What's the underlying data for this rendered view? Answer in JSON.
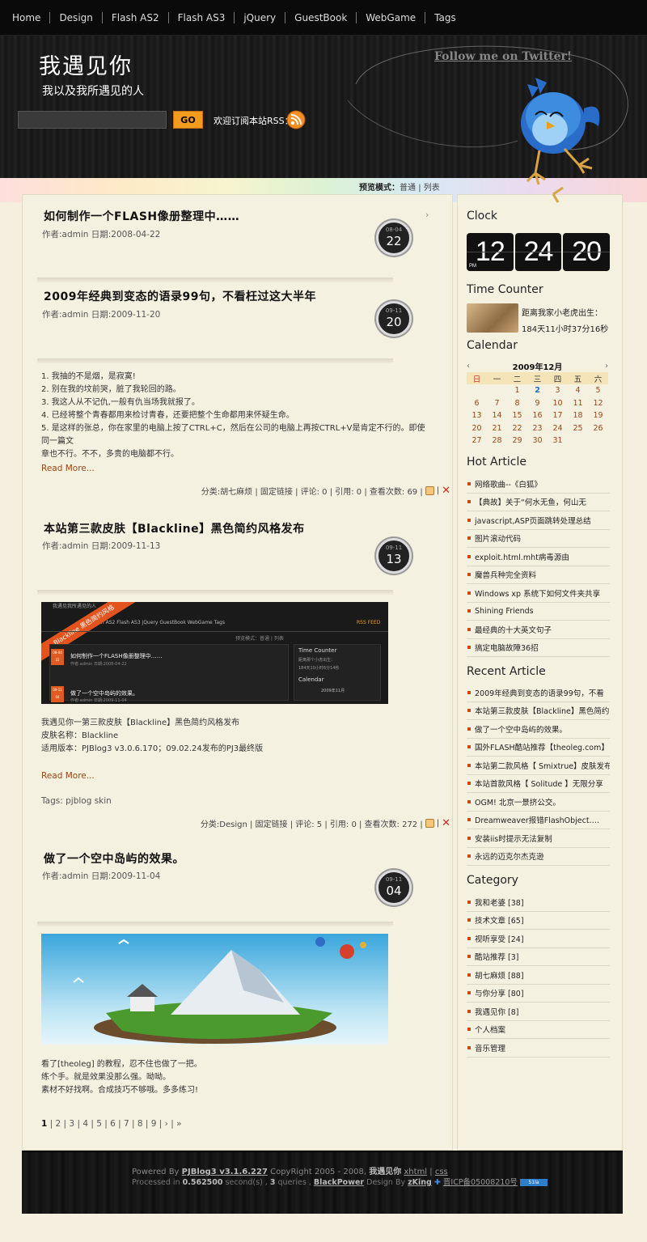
{
  "nav": {
    "items": [
      "Home",
      "Design",
      "Flash AS2",
      "Flash AS3",
      "jQuery",
      "GuestBook",
      "WebGame",
      "Tags"
    ]
  },
  "header": {
    "title": "我遇见你",
    "subtitle": "我以及我所遇见的人",
    "twitter": "Follow me on Twitter!",
    "search_button": "GO",
    "rss_label": "欢迎订阅本站RSS："
  },
  "preview": {
    "label": "预览模式：",
    "normal": "普通",
    "sep": "|",
    "list": "列表"
  },
  "posts": [
    {
      "title": "如何制作一个FLASH像册整理中……",
      "meta": "作者:admin  日期:2008-04-22",
      "month": "08-04",
      "day": "22"
    },
    {
      "title": "2009年经典到变态的语录99句，不看枉过这大半年",
      "meta": "作者:admin  日期:2009-11-20",
      "month": "09-11",
      "day": "20",
      "lines": [
        "1. 我抽的不是烟，是寂寞!",
        "2. 别在我的坟前哭，脏了我轮回的路。",
        "3. 我这人从不记仇,一般有仇当场我就报了。",
        "4. 已经将整个青春都用来检讨青春，还要把整个生命都用来怀疑生命。",
        "5. 是这样的张总，你在家里的电脑上按了CTRL+C，然后在公司的电脑上再按CTRL+V是肯定不行的。即使同一篇文",
        "章也不行。不不，多贵的电脑都不行。"
      ],
      "read_more": "Read More...",
      "footer": "分类:胡七麻烦 | 固定链接 | 评论: 0 | 引用: 0 | 查看次数: 69 |"
    },
    {
      "title": "本站第三款皮肤【Blackline】黑色简约风格发布",
      "meta": "作者:admin  日期:2009-11-13",
      "month": "09-11",
      "day": "13",
      "lines": [
        "我遇见你一第三款皮肤【Blackline】黑色简约风格发布",
        "皮肤名称：Blackline",
        "适用版本：PJBlog3 v3.0.6.170；09.02.24发布的PJ3最终版"
      ],
      "read_more": "Read More...",
      "tags": "Tags: pjblog skin",
      "footer": "分类:Design | 固定链接 | 评论: 5 | 引用: 0 | 查看次数: 272 |",
      "thumb": {
        "banner": "Blackline 黑色简约风格",
        "nav": "Flash AS2   Flash AS3   jQuery   GuestBook   WebGame   Tags",
        "rss": "RSS FEED",
        "site": "我遇见我所遇见的人",
        "preview": "预览模式：普通 | 列表",
        "p1": "如何制作一个FLASH像册整理中……",
        "p1_meta": "作者:admin  日期:2008-04-22",
        "p1_month": "08-04",
        "p1_day": "22",
        "p2": "做了一个空中岛屿的效果。",
        "p2_meta": "作者:admin  日期:2009-11-04",
        "p2_month": "09-11",
        "p2_day": "04",
        "side1": "Time Counter",
        "side1_text": "距离那个小虎出生：",
        "side1_val": "184天10小时6分14秒",
        "side2": "Calendar",
        "side2_month": "2009年11月"
      }
    },
    {
      "title": "做了一个空中岛屿的效果。",
      "meta": "作者:admin  日期:2009-11-04",
      "month": "09-11",
      "day": "04",
      "lines": [
        "看了[theoleg] 的教程，忍不住也做了一把。",
        "练个手。就是效果没那么强。呦呦。",
        "素材不好找啊。合成技巧不够哦。多多练习!"
      ]
    }
  ],
  "pager": {
    "current": "1",
    "rest": "| 2 | 3 | 4 | 5 | 6 | 7 | 8 | 9 | › | »"
  },
  "sidebar": {
    "clock_title": "Clock",
    "clock": {
      "h": "12",
      "m": "24",
      "s": "20",
      "ampm": "PM"
    },
    "tc_title": "Time Counter",
    "tc_line1": "距离我家小老虎出生：",
    "tc_line2": "184天11小时37分16秒",
    "cal_title": "Calendar",
    "cal_month": "2009年12月",
    "cal_prev": "‹",
    "cal_next": "›",
    "weekdays": [
      "日",
      "一",
      "二",
      "三",
      "四",
      "五",
      "六"
    ],
    "weeks": [
      [
        "",
        "",
        "1",
        "2",
        "3",
        "4",
        "5"
      ],
      [
        "6",
        "7",
        "8",
        "9",
        "10",
        "11",
        "12"
      ],
      [
        "13",
        "14",
        "15",
        "16",
        "17",
        "18",
        "19"
      ],
      [
        "20",
        "21",
        "22",
        "23",
        "24",
        "25",
        "26"
      ],
      [
        "27",
        "28",
        "29",
        "30",
        "31",
        "",
        ""
      ]
    ],
    "today": "2",
    "hot_title": "Hot Article",
    "hot": [
      "网络歌曲--《白狐》",
      "【典故】关于“何水无鱼，何山无",
      "javascript,ASP页面跳转处理总结",
      "图片滚动代码",
      "exploit.html.mht病毒源由",
      "魔兽兵种完全资料",
      "Windows  xp 系统下如何文件夹共享",
      "Shining Friends",
      "最经典的十大英文句子",
      "搞定电脑故障36招"
    ],
    "recent_title": "Recent Article",
    "recent": [
      "2009年经典到变态的语录99句，不看",
      "本站第三款皮肤【Blackline】黑色简约",
      "做了一个空中岛屿的效果。",
      "国外FLASH酷站推荐【theoleg.com】",
      "本站第二款风格【  Smixtrue】皮肤发布",
      "本站首款风格【  Solitude 】无限分享",
      "OGM! 北京一景挤公交。",
      "Dreamweaver报错FlashObject.…",
      "安装iis时提示无法复制",
      "永远的迈克尔杰克逊"
    ],
    "cat_title": "Category",
    "categories": [
      "我和老婆 [38]",
      "技术文章 [65]",
      "视听享受 [24]",
      "酷站推荐 [3]",
      "胡七麻烦 [88]",
      "与你分享 [80]",
      "我遇见你 [8]",
      "个人档案",
      "音乐管理"
    ]
  },
  "footer": {
    "powered": "Powered By",
    "engine": "PJBlog3 v3.1.6.227",
    "copyright": "CopyRight 2005 - 2008,",
    "site": "我遇见你",
    "xhtml": "xhtml",
    "css": "css",
    "processed": "Processed in",
    "seconds": "0.562500",
    "sec_label": "second(s) ,",
    "queries": "3",
    "q_label": "queries ,",
    "theme": "BlackPower",
    "design": "Design By",
    "designer": "zKing",
    "icp": "晋ICP备05008210号",
    "badge": "51la"
  }
}
